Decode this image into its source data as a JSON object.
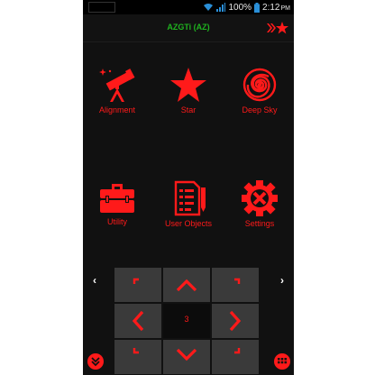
{
  "status": {
    "battery": "100%",
    "time": "2:12",
    "ampm": "PM",
    "icons": [
      "wifi-icon",
      "signal-icon",
      "battery-icon"
    ]
  },
  "header": {
    "title": "AZGTi (AZ)",
    "right_icon": "double-chevron-star-icon",
    "title_color": "#1fb31f",
    "accent_color": "#ff1a1a"
  },
  "menu": [
    {
      "label": "Alignment",
      "icon": "telescope-icon"
    },
    {
      "label": "Star",
      "icon": "star-icon"
    },
    {
      "label": "Deep Sky",
      "icon": "galaxy-icon"
    },
    {
      "label": "Utility",
      "icon": "toolbox-icon"
    },
    {
      "label": "User Objects",
      "icon": "notepad-icon"
    },
    {
      "label": "Settings",
      "icon": "settings-icon"
    }
  ],
  "controls": {
    "left_arrow": "‹",
    "right_arrow": "›",
    "rate": "3",
    "directions": [
      "up-left",
      "up",
      "up-right",
      "left",
      "right",
      "down-left",
      "down",
      "down-right"
    ],
    "bottom_left_icon": "expand-down-icon",
    "bottom_right_icon": "grid-menu-icon"
  }
}
